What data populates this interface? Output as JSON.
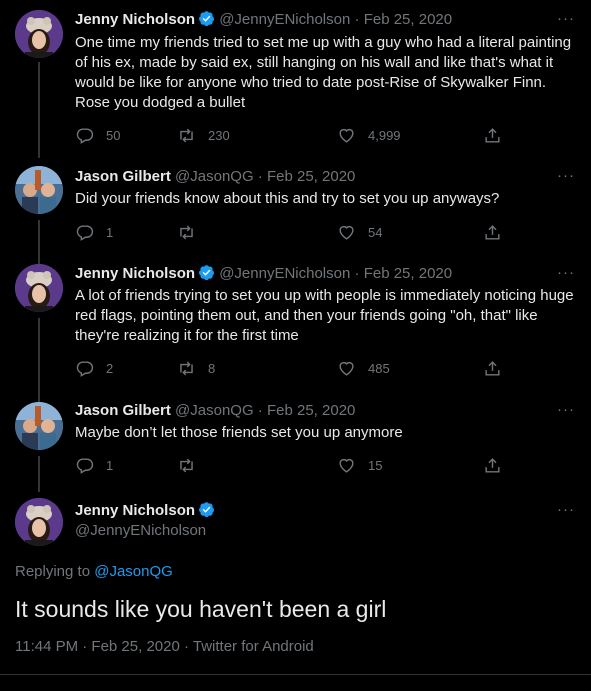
{
  "tweets": [
    {
      "name": "Jenny Nicholson",
      "handle": "@JennyENicholson",
      "sep": "·",
      "date": "Feb 25, 2020",
      "text": "One time my friends tried to set me up with a guy who had a literal painting of his ex, made by said ex, still hanging on his wall and like that's what it would be like for anyone who tried to date post-Rise of Skywalker Finn. Rose you dodged a bullet",
      "replies": "50",
      "retweets": "230",
      "likes": "4,999"
    },
    {
      "name": "Jason Gilbert",
      "handle": "@JasonQG",
      "sep": "·",
      "date": "Feb 25, 2020",
      "text": "Did your friends know about this and try to set you up anyways?",
      "replies": "1",
      "retweets": "",
      "likes": "54"
    },
    {
      "name": "Jenny Nicholson",
      "handle": "@JennyENicholson",
      "sep": "·",
      "date": "Feb 25, 2020",
      "text": "A lot of friends trying to set you up with people is immediately noticing huge red flags, pointing them out, and then your friends going \"oh, that\" like they're realizing it for the first time",
      "replies": "2",
      "retweets": "8",
      "likes": "485"
    },
    {
      "name": "Jason Gilbert",
      "handle": "@JasonQG",
      "sep": "·",
      "date": "Feb 25, 2020",
      "text": "Maybe don’t let those friends set you up anymore",
      "replies": "1",
      "retweets": "",
      "likes": "15"
    }
  ],
  "focus": {
    "name": "Jenny Nicholson",
    "handle": "@JennyENicholson",
    "replying_prefix": "Replying to",
    "replying_to": "@JasonQG",
    "text": "It sounds like you haven't been a girl",
    "time": "11:44 PM · Feb 25, 2020 · Twitter for Android"
  },
  "more_glyph": "···",
  "colors": {
    "background": "#000000",
    "text": "#e7e9ea",
    "muted": "#71767b",
    "link": "#1d9bf0",
    "verified": "#1d9bf0"
  }
}
